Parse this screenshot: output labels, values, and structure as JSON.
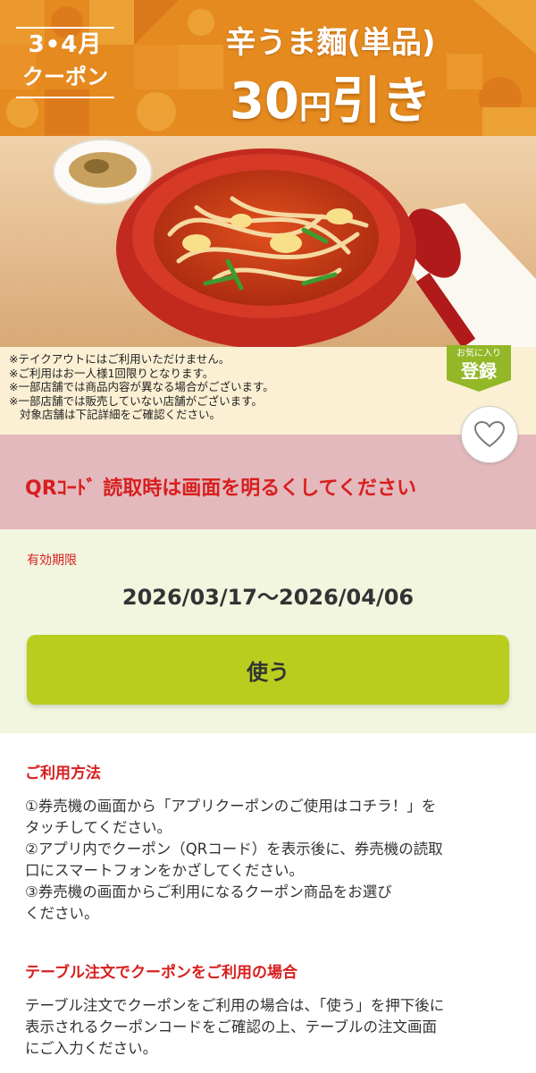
{
  "banner": {
    "period_line1": "3•4月",
    "period_line2": "クーポン",
    "title": "辛うま麵(単品)",
    "discount_number": "30",
    "discount_unit": "円",
    "discount_suffix": "引き"
  },
  "notes": [
    "※テイクアウトにはご利用いただけません。",
    "※ご利用はお一人様1回限りとなります。",
    "※一部店舗では商品内容が異なる場合がございます。",
    "※一部店舗では販売していない店舗がございます。",
    "対象店舗は下記詳細をご確認ください。"
  ],
  "favorite_badge": {
    "top": "お気に入り",
    "main": "登録"
  },
  "qr_notice": "QRｺｰﾄﾞ 読取時は画面を明るくしてください",
  "validity": {
    "label": "有効期限",
    "dates": "2026/03/17～2026/04/06"
  },
  "use_button_label": "使う",
  "usage": {
    "heading": "ご利用方法",
    "steps": [
      "①券売機の画面から「アプリクーポンのご使用はコチラ！」を",
      "タッチしてください。",
      "②アプリ内でクーポン（QRコード）を表示後に、券売機の読取",
      "口にスマートフォンをかざしてください。",
      "③券売機の画面からご利用になるクーポン商品をお選び",
      "ください。"
    ]
  },
  "table_order": {
    "heading": "テーブル注文でクーポンをご利用の場合",
    "lines": [
      "テーブル注文でクーポンをご利用の場合は、「使う」を押下後に",
      "表示されるクーポンコードをご確認の上、テーブルの注文画面",
      "にご入力ください。"
    ]
  },
  "colors": {
    "banner_orange": "#e58a1f",
    "accent_red": "#d81e1e",
    "button_green": "#b9cd1f",
    "badge_green": "#93b727",
    "notice_pink": "#e3b9bd"
  },
  "icons": {
    "favorite": "heart-icon"
  }
}
